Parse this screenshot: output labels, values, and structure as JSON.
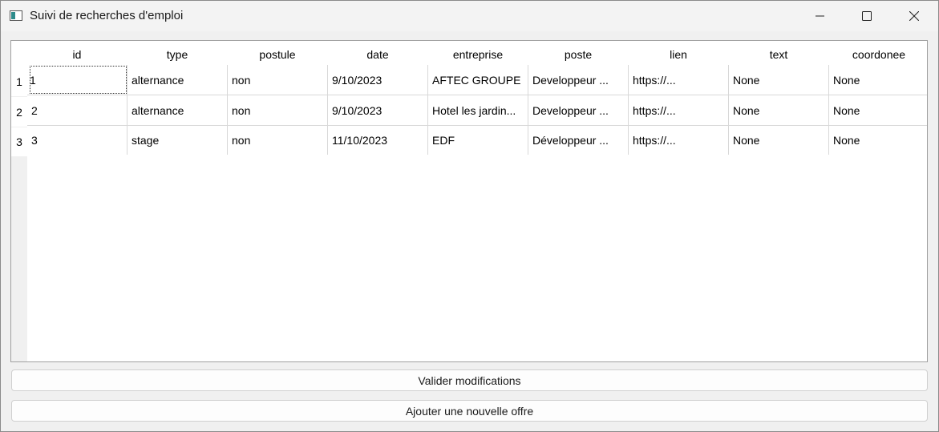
{
  "window": {
    "title": "Suivi de recherches d'emploi"
  },
  "table": {
    "columns": [
      "id",
      "type",
      "postule",
      "date",
      "entreprise",
      "poste",
      "lien",
      "text",
      "coordonee"
    ],
    "row_numbers": [
      "1",
      "2",
      "3"
    ],
    "rows": [
      [
        "1",
        "alternance",
        "non",
        "9/10/2023",
        "AFTEC GROUPE",
        "Developpeur ...",
        "https://...",
        "None",
        "None"
      ],
      [
        "2",
        "alternance",
        "non",
        "9/10/2023",
        "Hotel les jardin...",
        "Developpeur ...",
        "https://...",
        "None",
        "None"
      ],
      [
        "3",
        "stage",
        "non",
        "11/10/2023",
        "EDF",
        "Développeur ...",
        "https://...",
        "None",
        "None"
      ]
    ]
  },
  "buttons": {
    "validate": "Valider modifications",
    "add": "Ajouter une nouvelle offre"
  },
  "icons": {
    "app": "window-app-icon",
    "minimize": "minimize-icon",
    "maximize": "maximize-icon",
    "close": "close-icon"
  }
}
